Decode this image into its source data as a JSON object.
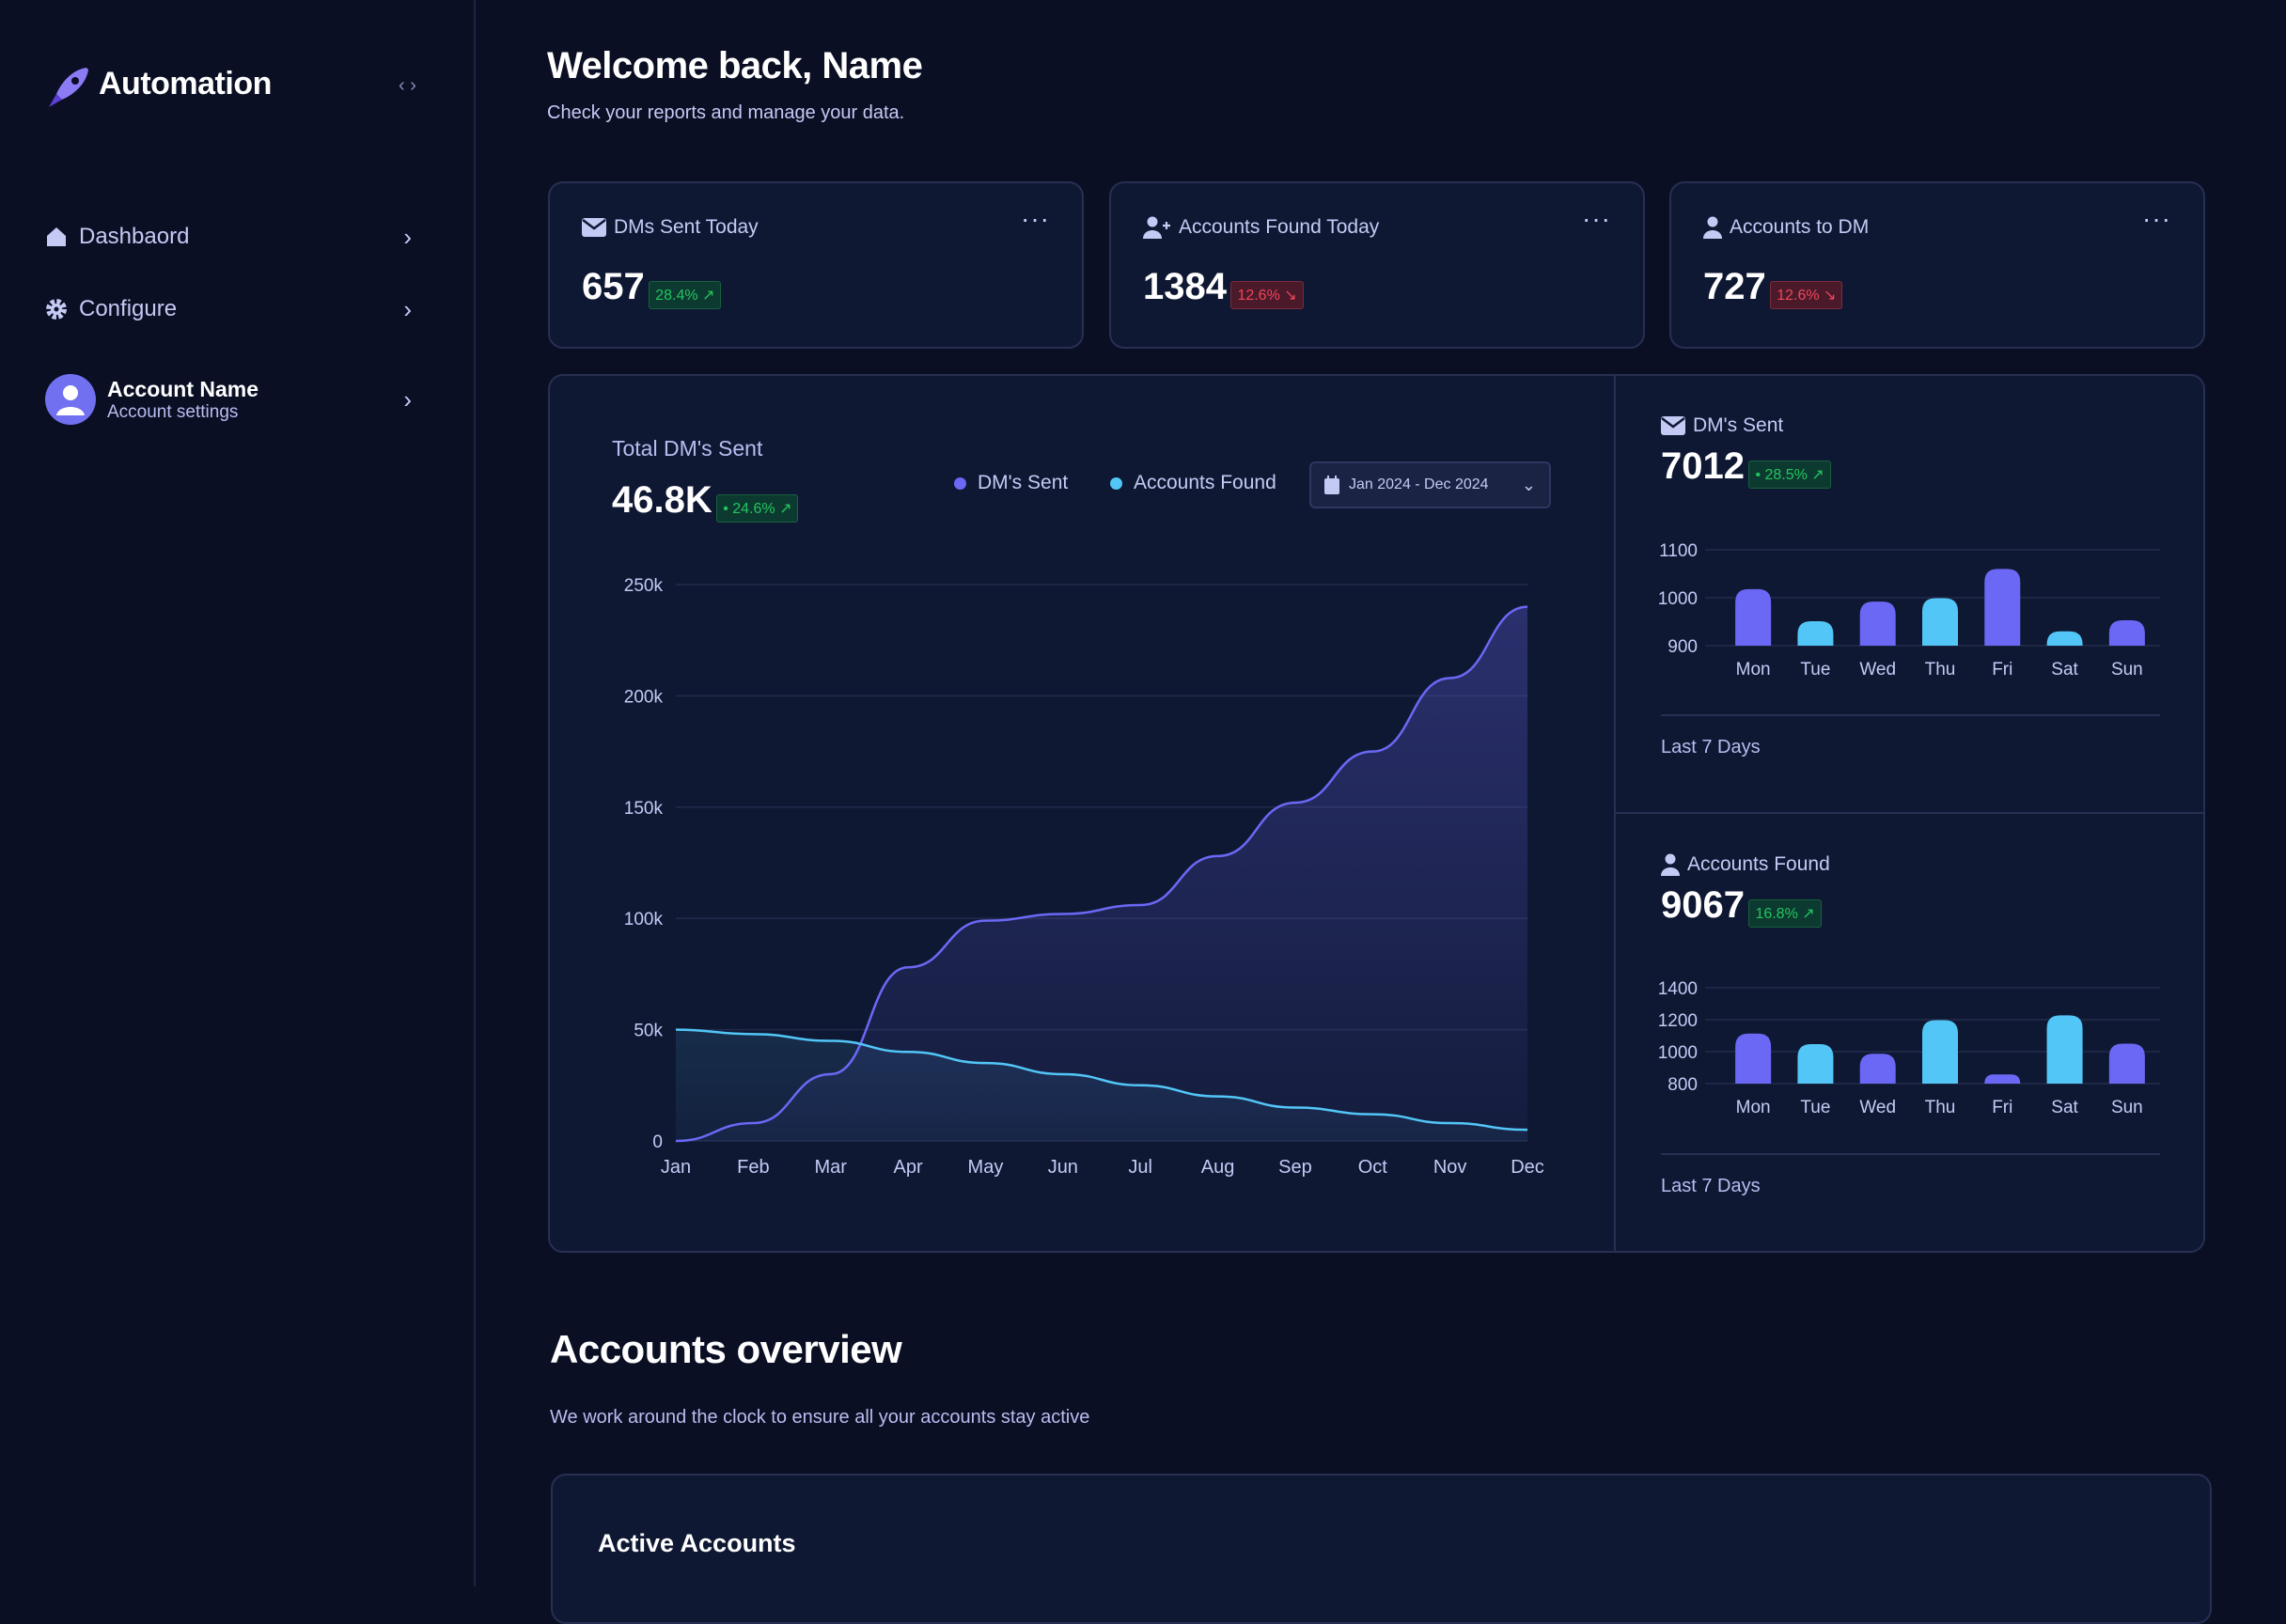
{
  "app": {
    "name": "Automation",
    "collapse_icon": "code-brackets-icon"
  },
  "sidebar": {
    "items": [
      {
        "label": "Dashbaord",
        "icon": "home-icon"
      },
      {
        "label": "Configure",
        "icon": "gear-icon"
      }
    ],
    "account": {
      "name": "Account Name",
      "subtitle": "Account settings"
    }
  },
  "header": {
    "title": "Welcome back, Name",
    "subtitle": "Check your reports and manage your data."
  },
  "stats": [
    {
      "label": "DMs Sent Today",
      "value": "657",
      "change": "28.4% ↗",
      "trend": "up",
      "icon": "envelope-icon"
    },
    {
      "label": "Accounts Found Today",
      "value": "1384",
      "change": "12.6% ↘",
      "trend": "down",
      "icon": "user-plus-icon"
    },
    {
      "label": "Accounts to DM",
      "value": "727",
      "change": "12.6% ↘",
      "trend": "down",
      "icon": "user-icon"
    }
  ],
  "colors": {
    "purple": "#6b68f5",
    "cyan": "#52c6f7",
    "green": "#22c55e",
    "red": "#f0455b",
    "bg": "#0a0f24",
    "card": "#0f1833"
  },
  "main_chart": {
    "title": "Total DM's Sent",
    "value": "46.8K",
    "change": "• 24.6% ↗",
    "date_range": "Jan 2024 - Dec 2024"
  },
  "side1": {
    "title": "DM's Sent",
    "value": "7012",
    "change": "• 28.5% ↗",
    "footer": "Last 7 Days"
  },
  "side2": {
    "title": "Accounts Found",
    "value": "9067",
    "change": "16.8% ↗",
    "footer": "Last 7 Days"
  },
  "overview": {
    "title": "Accounts overview",
    "subtitle": "We work around the clock to ensure all your accounts stay active",
    "card_title": "Active Accounts"
  },
  "chart_data": [
    {
      "type": "area",
      "x": [
        "Jan",
        "Feb",
        "Mar",
        "Apr",
        "May",
        "Jun",
        "Jul",
        "Aug",
        "Sep",
        "Oct",
        "Nov",
        "Dec"
      ],
      "yticks": [
        "0",
        "50k",
        "100k",
        "150k",
        "200k",
        "250k"
      ],
      "ylim": [
        0,
        250000
      ],
      "grid": true,
      "legend": "top",
      "series": [
        {
          "name": "DM's Sent",
          "color": "#6b68f5",
          "values": [
            0,
            8000,
            30000,
            78000,
            99000,
            102000,
            106000,
            128000,
            152000,
            175000,
            208000,
            240000
          ]
        },
        {
          "name": "Accounts Found",
          "color": "#52c6f7",
          "values": [
            50000,
            48000,
            45000,
            40000,
            35000,
            30000,
            25000,
            20000,
            15000,
            12000,
            8000,
            5000
          ]
        }
      ]
    },
    {
      "type": "bar",
      "categories": [
        "Mon",
        "Tue",
        "Wed",
        "Thu",
        "Fri",
        "Sat",
        "Sun"
      ],
      "yticks": [
        "900",
        "1000",
        "1100"
      ],
      "ylim": [
        900,
        1100
      ],
      "values": [
        1018,
        951,
        992,
        999,
        1060,
        930,
        953
      ],
      "colors": [
        "#6b68f5",
        "#52c6f7",
        "#6b68f5",
        "#52c6f7",
        "#6b68f5",
        "#52c6f7",
        "#6b68f5"
      ]
    },
    {
      "type": "bar",
      "categories": [
        "Mon",
        "Tue",
        "Wed",
        "Thu",
        "Fri",
        "Sat",
        "Sun"
      ],
      "yticks": [
        "800",
        "1000",
        "1200",
        "1400"
      ],
      "ylim": [
        800,
        1400
      ],
      "values": [
        1113,
        1047,
        987,
        1197,
        857,
        1227,
        1050
      ],
      "colors": [
        "#6b68f5",
        "#52c6f7",
        "#6b68f5",
        "#52c6f7",
        "#6b68f5",
        "#52c6f7",
        "#6b68f5"
      ]
    }
  ]
}
